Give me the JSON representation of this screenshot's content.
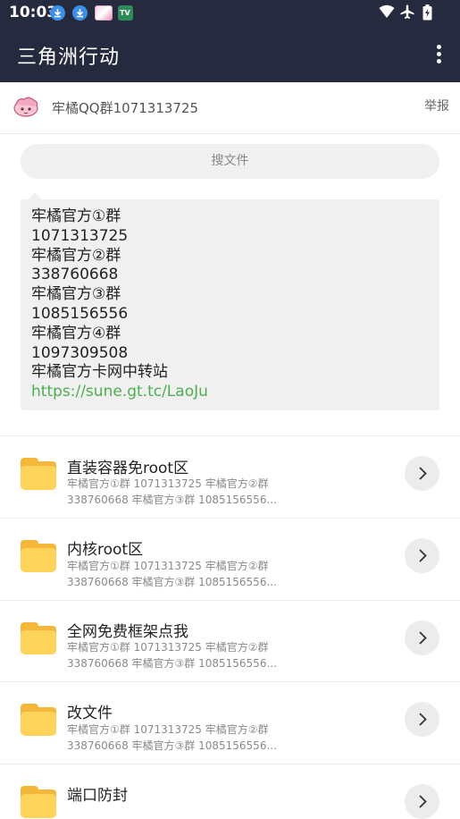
{
  "status_bar": {
    "time": "10:03",
    "app_icon_label": "TV"
  },
  "app_bar": {
    "title": "三角洲行动"
  },
  "group": {
    "name": "牢橘QQ群1071313725",
    "report_label": "举报"
  },
  "search": {
    "placeholder": "搜文件"
  },
  "message": {
    "lines": [
      "牢橘官方①群",
      "1071313725",
      "牢橘官方②群",
      "338760668",
      "牢橘官方③群",
      "1085156556",
      "牢橘官方④群",
      "1097309508",
      "牢橘官方卡网中转站"
    ],
    "link": "https://sune.gt.tc/LaoJu"
  },
  "folders": [
    {
      "title": "直装容器免root区",
      "desc_line1": "牢橘官方①群 1071313725 牢橘官方②群",
      "desc_line2": "338760668 牢橘官方③群 1085156556..."
    },
    {
      "title": "内核root区",
      "desc_line1": "牢橘官方①群 1071313725 牢橘官方②群",
      "desc_line2": "338760668 牢橘官方③群 1085156556..."
    },
    {
      "title": "全网免费框架点我",
      "desc_line1": "牢橘官方①群 1071313725 牢橘官方②群",
      "desc_line2": "338760668 牢橘官方③群 1085156556..."
    },
    {
      "title": "改文件",
      "desc_line1": "牢橘官方①群 1071313725 牢橘官方②群",
      "desc_line2": "338760668 牢橘官方③群 1085156556..."
    },
    {
      "title": "端口防封"
    }
  ],
  "colors": {
    "app_bar_bg": "#262a3f",
    "link": "#4caf50",
    "folder": "#fdd35a"
  }
}
